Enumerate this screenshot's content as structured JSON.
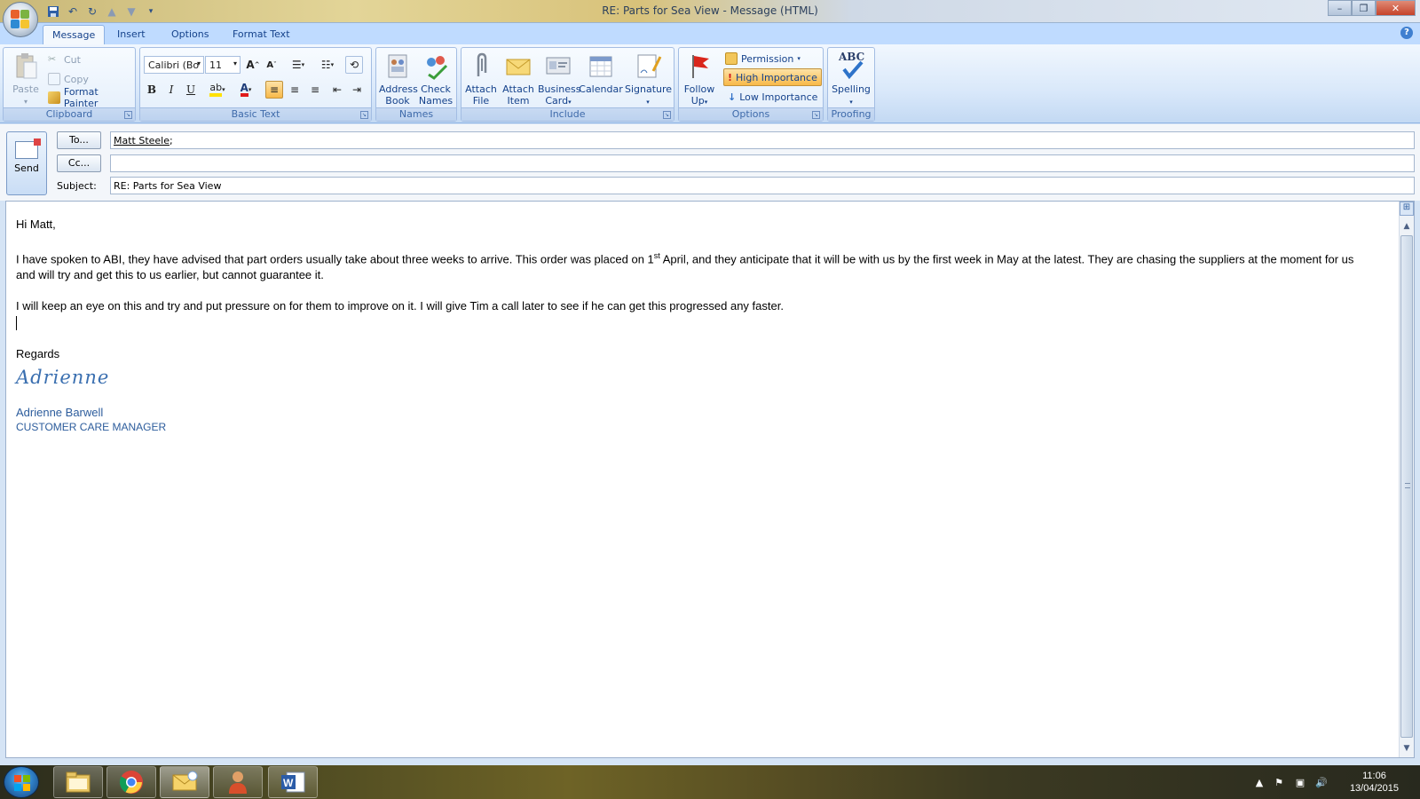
{
  "window": {
    "title": "RE: Parts for Sea View - Message (HTML)"
  },
  "tabs": [
    "Message",
    "Insert",
    "Options",
    "Format Text"
  ],
  "ribbon": {
    "clipboard": {
      "label": "Clipboard",
      "paste": "Paste",
      "cut": "Cut",
      "copy": "Copy",
      "format_painter": "Format Painter"
    },
    "basic_text": {
      "label": "Basic Text",
      "font": "Calibri (Bo",
      "size": "11",
      "bold": "B",
      "italic": "I",
      "underline": "U"
    },
    "names": {
      "label": "Names",
      "address_book": [
        "Address",
        "Book"
      ],
      "check_names": [
        "Check",
        "Names"
      ]
    },
    "include": {
      "label": "Include",
      "attach_file": [
        "Attach",
        "File"
      ],
      "attach_item": [
        "Attach",
        "Item"
      ],
      "business_card": [
        "Business",
        "Card"
      ],
      "calendar": "Calendar",
      "signature": "Signature"
    },
    "options": {
      "label": "Options",
      "follow_up": [
        "Follow",
        "Up"
      ],
      "permission": "Permission",
      "high_importance": "High Importance",
      "low_importance": "Low Importance"
    },
    "proofing": {
      "label": "Proofing",
      "spelling": "Spelling",
      "abc": "ABC"
    }
  },
  "header": {
    "send": "Send",
    "to_button": "To...",
    "cc_button": "Cc...",
    "subject_label": "Subject:",
    "to_value": "Matt Steele",
    "to_suffix": ";",
    "cc_value": "",
    "subject_value": "RE: Parts for Sea View"
  },
  "body": {
    "greeting": "Hi Matt,",
    "p1_a": "I have spoken to ABI, they have advised that part orders usually take about three weeks to arrive.  This order was placed on 1",
    "p1_sup": "st",
    "p1_b": " April, and they anticipate that it will be with us by the first week in May at the latest.  They are chasing the suppliers at the moment for us and will try and get this to us earlier, but cannot guarantee it.",
    "p2": "I will keep an eye on this and try and put pressure on for them to improve on it.  I will give Tim a call later to see if he can get this progressed any faster.",
    "regards": "Regards",
    "signature_script": "Adrienne",
    "sig_name": "Adrienne Barwell",
    "sig_title": "CUSTOMER CARE MANAGER"
  },
  "taskbar": {
    "time": "11:06",
    "date": "13/04/2015",
    "apps": [
      "windows-explorer",
      "chrome",
      "outlook",
      "contacts",
      "word"
    ]
  },
  "colors": {
    "ribbon_blue": "#15428b",
    "high_importance_bg": "#f8b949",
    "signature_blue": "#2c5c9c"
  }
}
